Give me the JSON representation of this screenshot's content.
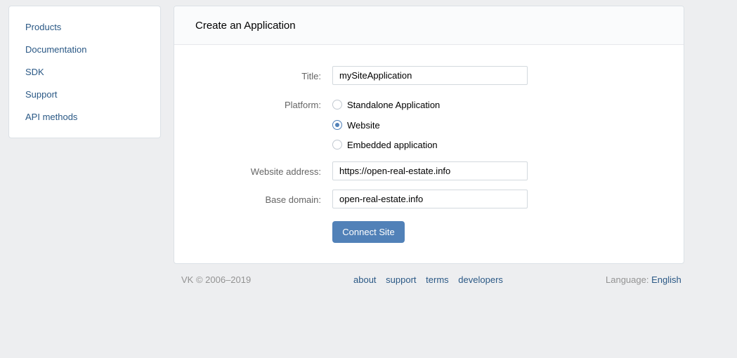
{
  "sidebar": {
    "items": [
      {
        "label": "Products"
      },
      {
        "label": "Documentation"
      },
      {
        "label": "SDK"
      },
      {
        "label": "Support"
      },
      {
        "label": "API methods"
      }
    ]
  },
  "form": {
    "heading": "Create an Application",
    "title_label": "Title:",
    "title_value": "mySiteApplication",
    "platform_label": "Platform:",
    "platform_options": [
      {
        "label": "Standalone Application",
        "selected": false
      },
      {
        "label": "Website",
        "selected": true
      },
      {
        "label": "Embedded application",
        "selected": false
      }
    ],
    "website_label": "Website address:",
    "website_value": "https://open-real-estate.info",
    "domain_label": "Base domain:",
    "domain_value": "open-real-estate.info",
    "submit_label": "Connect Site"
  },
  "footer": {
    "copyright": "VK © 2006–2019",
    "links": [
      "about",
      "support",
      "terms",
      "developers"
    ],
    "language_label": "Language:",
    "language_value": "English"
  },
  "colors": {
    "accent": "#5181b8",
    "link": "#2a5885",
    "background": "#edeef0"
  }
}
